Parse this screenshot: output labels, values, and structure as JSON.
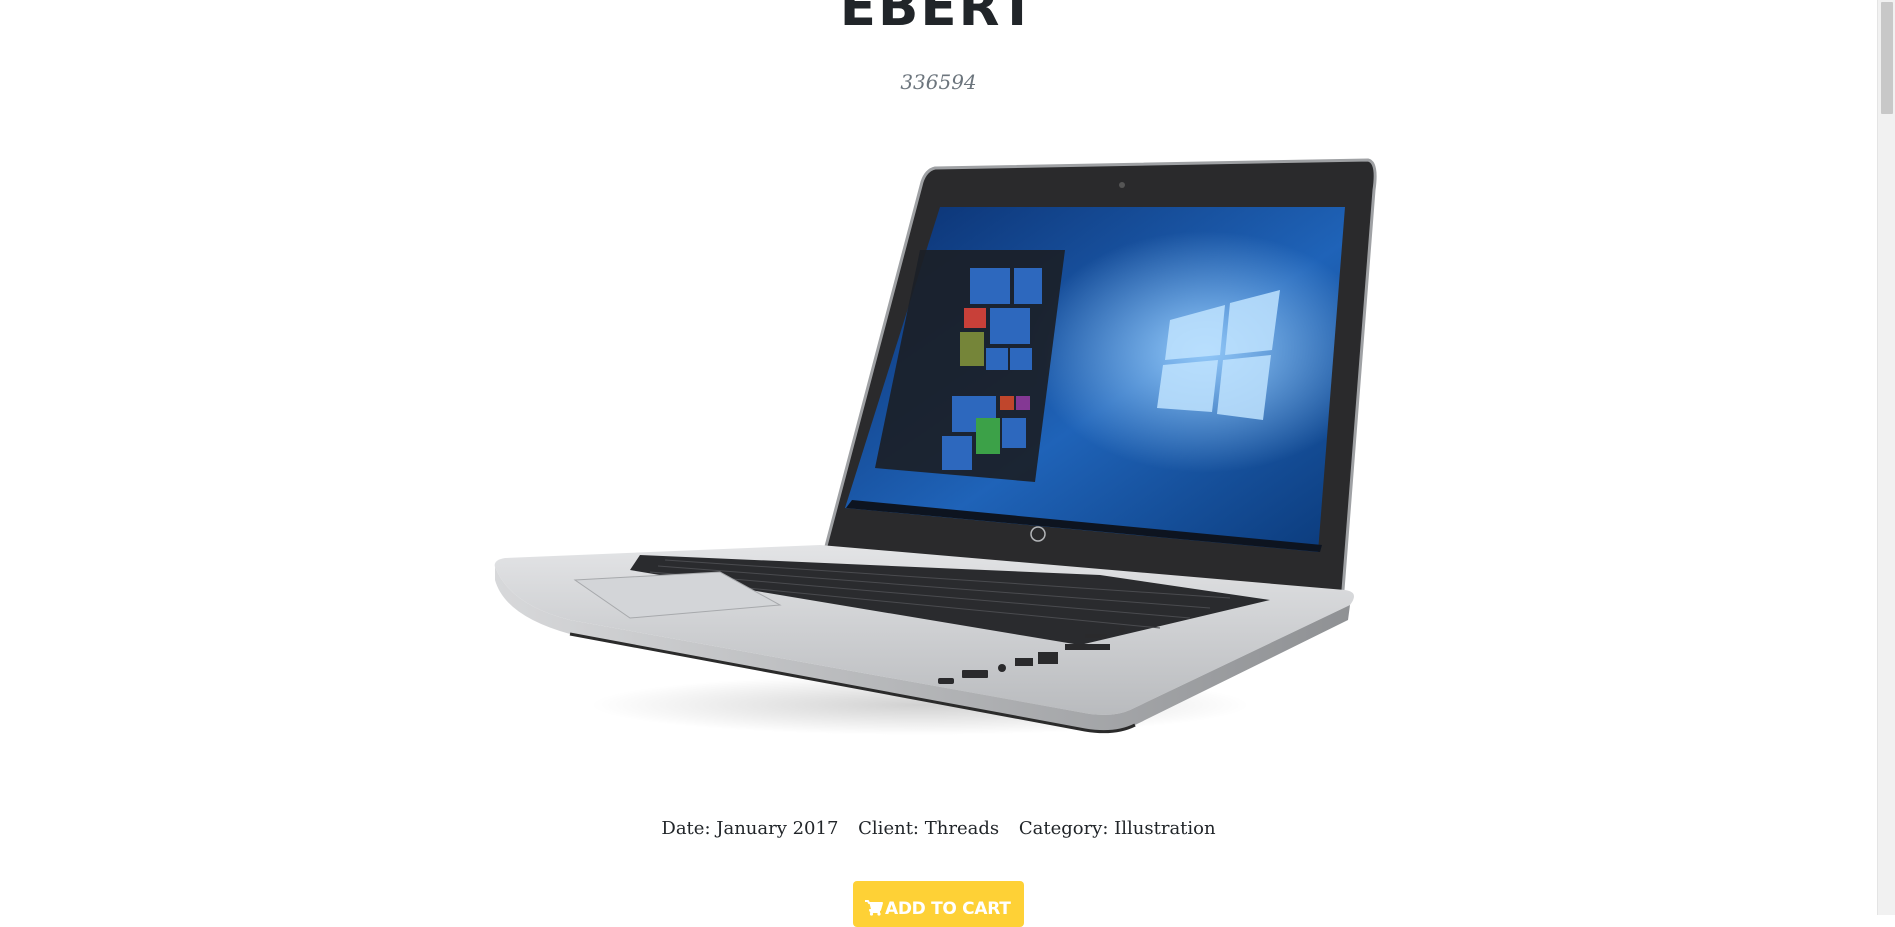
{
  "product": {
    "title": "EBERT",
    "subtitle": "336594",
    "image_alt": "HP laptop",
    "meta": {
      "date_label": "Date:",
      "date_value": "January 2017",
      "client_label": "Client:",
      "client_value": "Threads",
      "category_label": "Category:",
      "category_value": "Illustration"
    },
    "cart_button_label": "ADD TO CART",
    "cart_icon": "shopping-cart-icon"
  },
  "colors": {
    "accent": "#fed136",
    "heading": "#212529",
    "muted": "#6c757d"
  }
}
